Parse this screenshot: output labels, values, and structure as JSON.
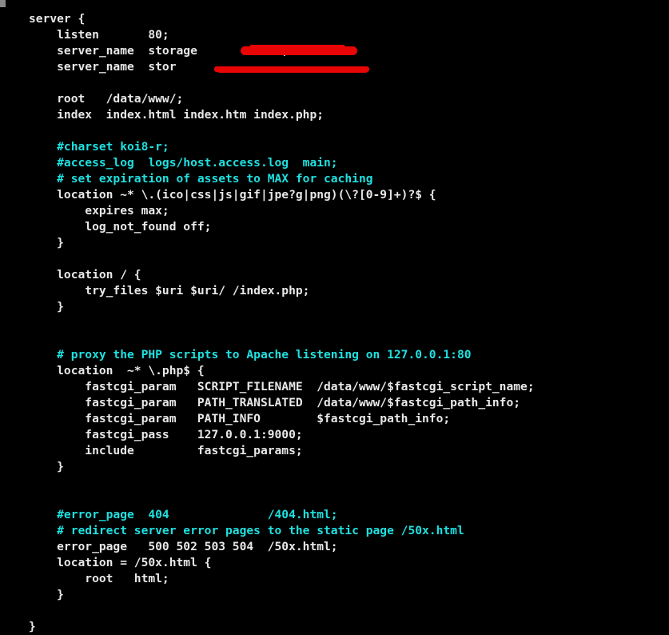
{
  "terminal": {
    "title": "nginx server block configuration",
    "background_color": "#000000",
    "code_color": "#e8e8e8",
    "comment_color": "#1fe0e0",
    "redaction_color": "#e90505"
  },
  "redactions": [
    {
      "name": "server-name-redaction-1",
      "line_index": 2,
      "style": "thick-brush-stroke"
    },
    {
      "name": "server-name-redaction-2",
      "line_index": 3,
      "style": "thin-strikethrough"
    }
  ],
  "code": {
    "lines": [
      {
        "text": "server {",
        "type": "code"
      },
      {
        "text": "    listen       80;",
        "type": "code"
      },
      {
        "text": "    server_name  storage            ;",
        "type": "code"
      },
      {
        "text": "    server_name  stor                ",
        "type": "code"
      },
      {
        "text": "",
        "type": "blank"
      },
      {
        "text": "    root   /data/www/;",
        "type": "code"
      },
      {
        "text": "    index  index.html index.htm index.php;",
        "type": "code"
      },
      {
        "text": "",
        "type": "blank"
      },
      {
        "text": "    #charset koi8-r;",
        "type": "comment"
      },
      {
        "text": "    #access_log  logs/host.access.log  main;",
        "type": "comment"
      },
      {
        "text": "    # set expiration of assets to MAX for caching",
        "type": "comment"
      },
      {
        "text": "    location ~* \\.(ico|css|js|gif|jpe?g|png)(\\?[0-9]+)?$ {",
        "type": "code"
      },
      {
        "text": "        expires max;",
        "type": "code"
      },
      {
        "text": "        log_not_found off;",
        "type": "code"
      },
      {
        "text": "    }",
        "type": "code"
      },
      {
        "text": "",
        "type": "blank"
      },
      {
        "text": "    location / {",
        "type": "code"
      },
      {
        "text": "        try_files $uri $uri/ /index.php;",
        "type": "code"
      },
      {
        "text": "    }",
        "type": "code"
      },
      {
        "text": "",
        "type": "blank"
      },
      {
        "text": "",
        "type": "blank"
      },
      {
        "text": "    # proxy the PHP scripts to Apache listening on 127.0.0.1:80",
        "type": "comment"
      },
      {
        "text": "    location  ~* \\.php$ {",
        "type": "code"
      },
      {
        "text": "        fastcgi_param   SCRIPT_FILENAME  /data/www/$fastcgi_script_name;",
        "type": "code"
      },
      {
        "text": "        fastcgi_param   PATH_TRANSLATED  /data/www/$fastcgi_path_info;",
        "type": "code"
      },
      {
        "text": "        fastcgi_param   PATH_INFO        $fastcgi_path_info;",
        "type": "code"
      },
      {
        "text": "        fastcgi_pass    127.0.0.1:9000;",
        "type": "code"
      },
      {
        "text": "        include         fastcgi_params;",
        "type": "code"
      },
      {
        "text": "    }",
        "type": "code"
      },
      {
        "text": "",
        "type": "blank"
      },
      {
        "text": "",
        "type": "blank"
      },
      {
        "text": "    #error_page  404              /404.html;",
        "type": "comment"
      },
      {
        "text": "    # redirect server error pages to the static page /50x.html",
        "type": "comment"
      },
      {
        "text": "    error_page   500 502 503 504  /50x.html;",
        "type": "code"
      },
      {
        "text": "    location = /50x.html {",
        "type": "code"
      },
      {
        "text": "        root   html;",
        "type": "code"
      },
      {
        "text": "    }",
        "type": "code"
      },
      {
        "text": "",
        "type": "blank"
      },
      {
        "text": "}",
        "type": "code"
      }
    ]
  }
}
